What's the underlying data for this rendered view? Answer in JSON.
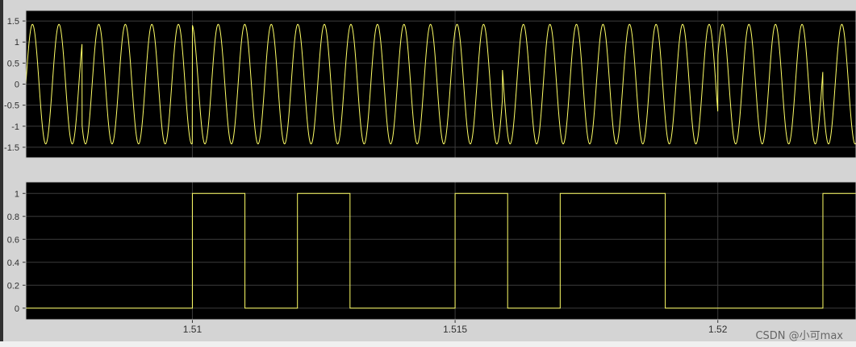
{
  "colors": {
    "background": "#000000",
    "frame": "#d4d4d4",
    "grid": "#3c3c3c",
    "axis": "#c8c8c8",
    "tick_text": "#303030",
    "trace": "#ffff66"
  },
  "watermark": "CSDN @小可max",
  "chart_data": [
    {
      "type": "line",
      "name": "top-plot",
      "xlim": [
        1.50683,
        1.52263
      ],
      "ylim": [
        -1.75,
        1.75
      ],
      "y_ticks": [
        1.5,
        1,
        0.5,
        0,
        -0.5,
        -1,
        -1.5
      ],
      "y_tick_labels": [
        "1.5",
        "1",
        "0.5",
        "0",
        "-0.5",
        "-1",
        "-1.5"
      ],
      "x_gridlines": [
        1.51,
        1.515,
        1.52
      ],
      "grid": true,
      "series": [
        {
          "signal": "sine",
          "amplitude": 1.42,
          "frequency_hz": 1980,
          "phase_flip_times": [
            1.5079,
            1.51,
            1.5159,
            1.52,
            1.522
          ]
        }
      ]
    },
    {
      "type": "line",
      "name": "bottom-plot",
      "xlim": [
        1.50683,
        1.52263
      ],
      "ylim": [
        -0.1,
        1.1
      ],
      "y_ticks": [
        1,
        0.8,
        0.6,
        0.4,
        0.2,
        0
      ],
      "y_tick_labels": [
        "1",
        "0.8",
        "0.6",
        "0.4",
        "0.2",
        "0"
      ],
      "x_ticks": [
        1.51,
        1.515,
        1.52
      ],
      "x_tick_labels": [
        "1.51",
        "1.515",
        "1.52"
      ],
      "grid": true,
      "series": [
        {
          "step_points": [
            [
              1.50683,
              0
            ],
            [
              1.51,
              1
            ],
            [
              1.511,
              0
            ],
            [
              1.512,
              1
            ],
            [
              1.513,
              0
            ],
            [
              1.515,
              1
            ],
            [
              1.516,
              0
            ],
            [
              1.517,
              1
            ],
            [
              1.519,
              0
            ],
            [
              1.522,
              1
            ],
            [
              1.523,
              0
            ]
          ]
        }
      ]
    }
  ]
}
